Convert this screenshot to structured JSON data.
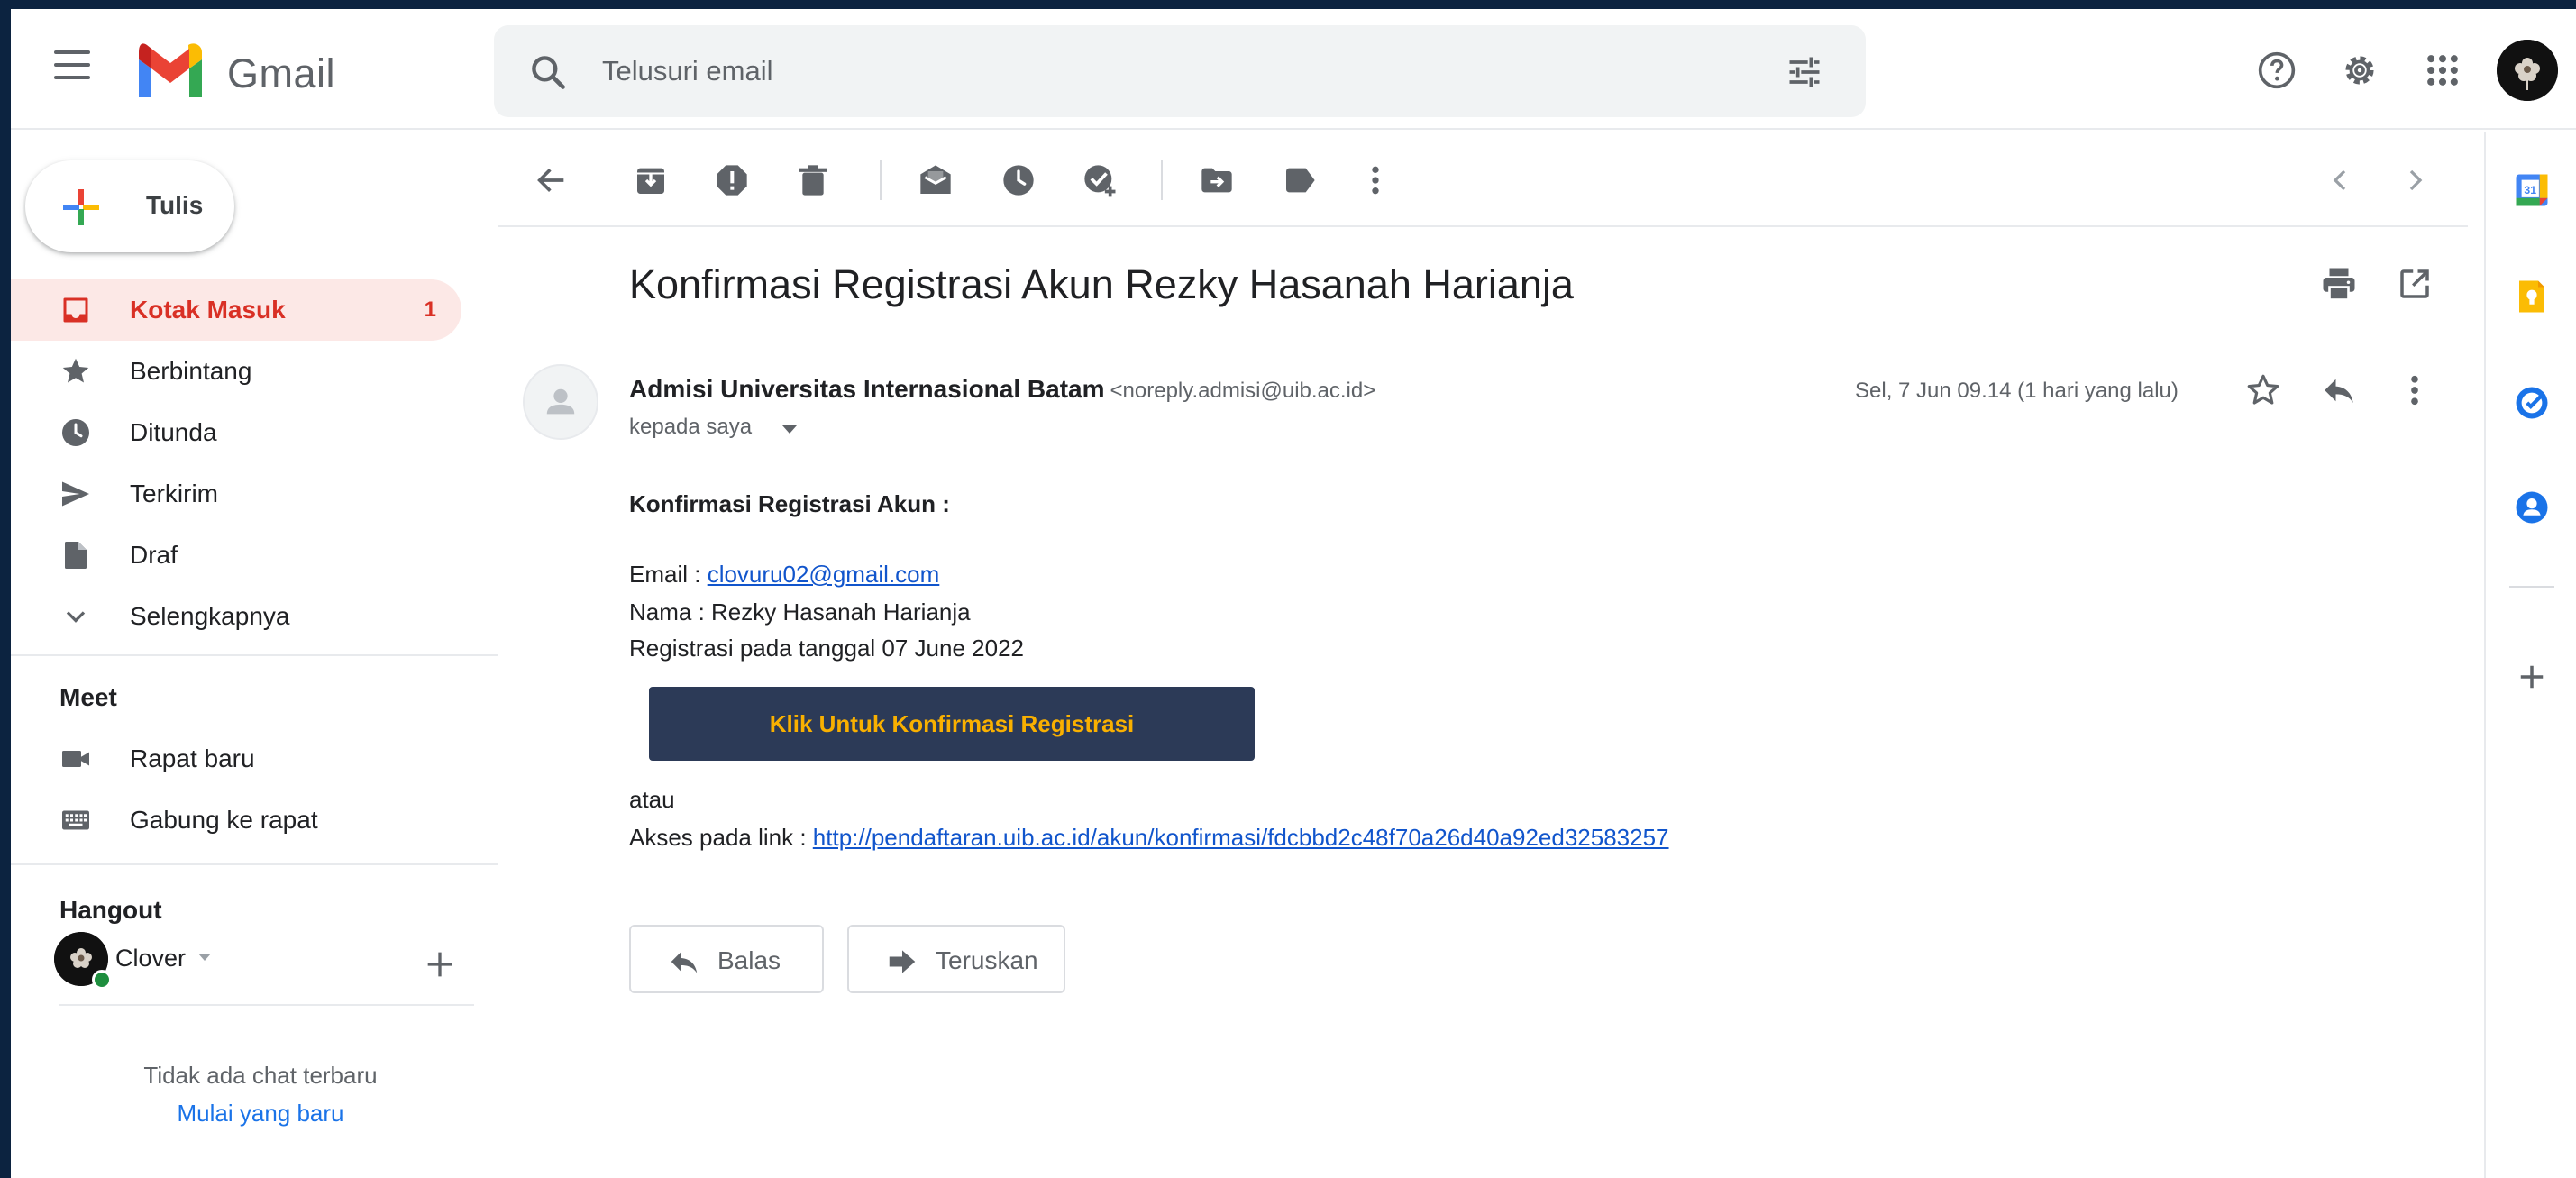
{
  "app": {
    "name": "Gmail"
  },
  "search": {
    "placeholder": "Telusuri email"
  },
  "compose": {
    "label": "Tulis"
  },
  "nav": {
    "items": [
      {
        "label": "Kotak Masuk",
        "count": "1",
        "icon": "inbox-icon",
        "active": true
      },
      {
        "label": "Berbintang",
        "icon": "star-icon"
      },
      {
        "label": "Ditunda",
        "icon": "clock-icon"
      },
      {
        "label": "Terkirim",
        "icon": "send-icon"
      },
      {
        "label": "Draf",
        "icon": "draft-icon"
      },
      {
        "label": "Selengkapnya",
        "icon": "chevron-down-icon"
      }
    ]
  },
  "meet": {
    "title": "Meet",
    "items": [
      {
        "label": "Rapat baru",
        "icon": "video-icon"
      },
      {
        "label": "Gabung ke rapat",
        "icon": "keyboard-icon"
      }
    ]
  },
  "hangout": {
    "title": "Hangout",
    "user": "Clover",
    "empty_text": "Tidak ada chat terbaru",
    "start_link": "Mulai yang baru"
  },
  "message": {
    "subject": "Konfirmasi Registrasi Akun Rezky Hasanah Harianja",
    "sender_name": "Admisi Universitas Internasional Batam",
    "sender_email": "<noreply.admisi@uib.ac.id>",
    "to": "kepada saya",
    "date": "Sel, 7 Jun 09.14 (1 hari yang lalu)",
    "body": {
      "heading": "Konfirmasi Registrasi Akun :",
      "email_label": "Email : ",
      "email_value": "clovuru02@gmail.com",
      "name_line": "Nama : Rezky Hasanah Harianja",
      "date_line": "Registrasi pada tanggal 07 June 2022",
      "cta_label": "Klik Untuk Konfirmasi Registrasi",
      "or_text": "atau",
      "link_label": "Akses pada link : ",
      "link_url": "http://pendaftaran.uib.ac.id/akun/konfirmasi/fdcbbd2c48f70a26d40a92ed32583257"
    },
    "actions": {
      "reply": "Balas",
      "forward": "Teruskan"
    }
  },
  "colors": {
    "accent_red": "#d93025",
    "link_blue": "#1155cc",
    "cta_bg": "#2c3a57",
    "cta_text": "#f9b000",
    "page_border": "#0c2340"
  }
}
